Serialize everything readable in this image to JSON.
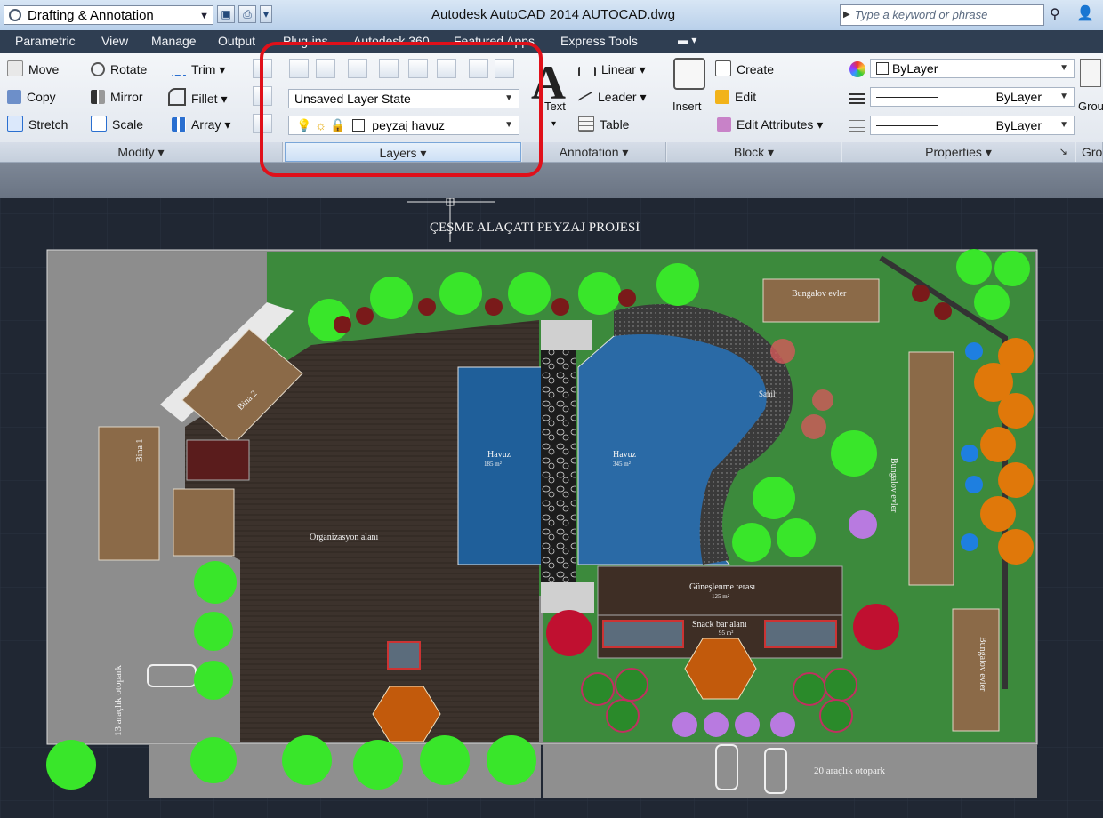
{
  "titlebar": {
    "workspace": "Drafting & Annotation",
    "app_title": "Autodesk AutoCAD 2014    AUTOCAD.dwg",
    "search_placeholder": "Type a keyword or phrase"
  },
  "menu": [
    "Parametric",
    "View",
    "Manage",
    "Output",
    "Plug-ins",
    "Autodesk 360",
    "Featured Apps",
    "Express Tools"
  ],
  "ribbon": {
    "modify": {
      "title": "Modify",
      "items": [
        "Move",
        "Rotate",
        "Trim",
        "Copy",
        "Mirror",
        "Fillet",
        "Stretch",
        "Scale",
        "Array"
      ]
    },
    "layers": {
      "title": "Layers",
      "layer_state": "Unsaved Layer State",
      "current_layer": "peyzaj havuz"
    },
    "annotation": {
      "title": "Annotation",
      "text_label": "Text",
      "items": [
        "Linear",
        "Leader",
        "Table"
      ]
    },
    "block": {
      "title": "Block",
      "insert_label": "Insert",
      "items": [
        "Create",
        "Edit",
        "Edit Attributes"
      ]
    },
    "properties": {
      "title": "Properties",
      "color": "ByLayer",
      "linetype": "ByLayer",
      "lineweight": "ByLayer"
    },
    "groups": {
      "title": "Gro",
      "label": "Grou"
    }
  },
  "drawing": {
    "title": "ÇEŞME ALAÇATI PEYZAJ PROJESİ",
    "labels": {
      "pool1": "Havuz",
      "pool1_area": "185 m²",
      "pool2": "Havuz",
      "pool2_area": "345 m²",
      "beach": "Sahil",
      "organization": "Organizasyon alanı",
      "sun_terrace": "Güneşlenme terası",
      "sun_terrace_area": "125 m²",
      "snack_bar": "Snack bar alanı",
      "snack_bar_area": "95 m²",
      "bungalow_top": "Bungalov evler",
      "bungalow_right": "Bungalov evler",
      "bungalow_bottom": "Bungalov evler",
      "building1": "Bina 1",
      "building2": "Bina 2",
      "parking_left": "13 araçlık otopark",
      "parking_bottom": "20 araçlık otopark"
    }
  },
  "colors": {
    "canvas": "#202733",
    "grass": "#3c8a3c",
    "deck": "#3a302b",
    "pool": "#1f5f9a",
    "highlight": "#e0101a"
  }
}
